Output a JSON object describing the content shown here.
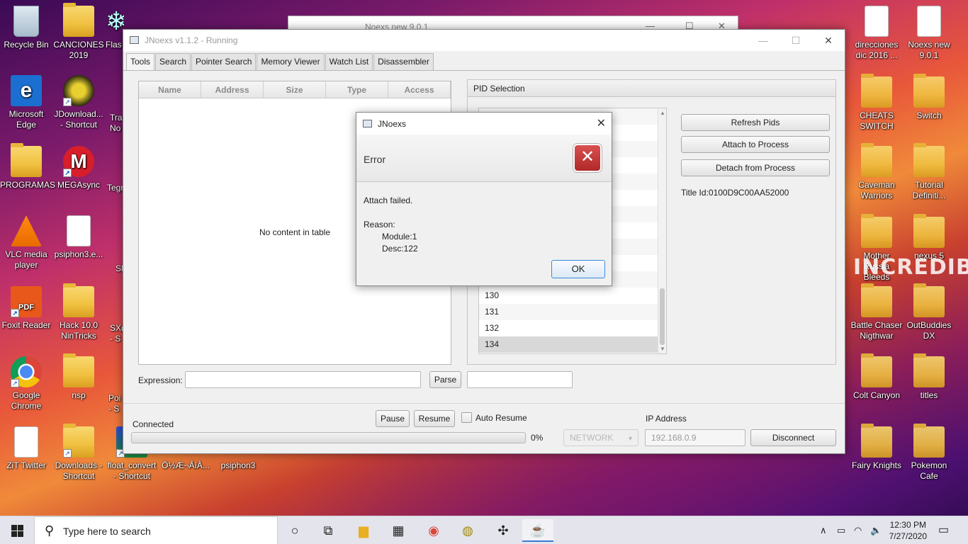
{
  "desktop": {
    "left_icons": [
      {
        "label": "Recycle Bin",
        "icon": "recycle-bin-icon"
      },
      {
        "label": "CANCIONES 2019",
        "icon": "folder-icon"
      },
      {
        "label": "Microsoft Edge",
        "icon": "edge-icon"
      },
      {
        "label": "JDownload... - Shortcut",
        "icon": "jdownloader-icon"
      },
      {
        "label": "PROGRAMAS",
        "icon": "folder-icon"
      },
      {
        "label": "MEGAsync",
        "icon": "mega-icon"
      },
      {
        "label": "VLC media player",
        "icon": "vlc-icon"
      },
      {
        "label": "psiphon3.e...",
        "icon": "file-icon"
      },
      {
        "label": "Foxit Reader",
        "icon": "foxit-icon"
      },
      {
        "label": "Hack 10.0 NinTricks",
        "icon": "folder-icon"
      },
      {
        "label": "Google Chrome",
        "icon": "chrome-icon"
      },
      {
        "label": "nsp",
        "icon": "folder-icon"
      },
      {
        "label": "ZiT Twitter",
        "icon": "document-icon"
      },
      {
        "label": "Downloads - Shortcut",
        "icon": "folder-icon"
      },
      {
        "label": "float_convert - Shortcut",
        "icon": "app-icon"
      },
      {
        "label": "Ö½Æ¬ÂíÀ...",
        "icon": "file-icon"
      },
      {
        "label": "psiphon3",
        "icon": "psiphon-icon"
      }
    ],
    "partial_labels": [
      "Flas",
      "Tra No",
      "Tegr",
      "Sl",
      "SX( - S",
      "Poi - S"
    ],
    "right_icons": [
      {
        "label": "direcciones dic 2016 ...",
        "icon": "document-icon"
      },
      {
        "label": "Noexs new 9.0.1",
        "icon": "file-icon"
      },
      {
        "label": "CHEATS SWITCH",
        "icon": "folder-icon"
      },
      {
        "label": "Switch",
        "icon": "folder-icon"
      },
      {
        "label": "Caveman Warriors",
        "icon": "folder-icon"
      },
      {
        "label": "Tutorial Definiti...",
        "icon": "folder-icon"
      },
      {
        "label": "Mother Russia Bleeds",
        "icon": "folder-icon"
      },
      {
        "label": "nexus 5",
        "icon": "folder-icon"
      },
      {
        "label": "Battle Chaser Nigthwar",
        "icon": "folder-icon"
      },
      {
        "label": "OutBuddies DX",
        "icon": "folder-icon"
      },
      {
        "label": "Colt Canyon",
        "icon": "folder-icon"
      },
      {
        "label": "titles",
        "icon": "folder-icon"
      },
      {
        "label": "Fairy Knights",
        "icon": "folder-icon"
      },
      {
        "label": "Pokemon Cafe",
        "icon": "folder-icon"
      }
    ],
    "wallpaper_text": "INCREDIBLE"
  },
  "background_window": {
    "title": "Noexs new 9.0.1"
  },
  "window": {
    "title": "JNoexs v1.1.2 - Running",
    "tabs": [
      "Tools",
      "Search",
      "Pointer Search",
      "Memory Viewer",
      "Watch List",
      "Disassembler"
    ],
    "active_tab": "Tools",
    "table": {
      "columns": [
        "Name",
        "Address",
        "Size",
        "Type",
        "Access"
      ],
      "empty_text": "No content in table"
    },
    "pid_panel": {
      "title": "PID Selection",
      "rows": [
        "",
        "",
        "",
        "",
        "",
        "",
        "",
        "",
        "",
        "",
        "",
        "130",
        "131",
        "132",
        "134"
      ],
      "selected": "134"
    },
    "buttons": {
      "refresh": "Refresh Pids",
      "attach": "Attach to Process",
      "detach": "Detach from Process",
      "parse": "Parse",
      "pause": "Pause",
      "resume": "Resume",
      "disconnect": "Disconnect"
    },
    "title_id": "Title Id:0100D9C00AA52000",
    "expression_label": "Expression:",
    "expression_value": "",
    "parse_result": "",
    "status": "Connected",
    "progress_percent": 0,
    "progress_text": "0%",
    "auto_resume_label": "Auto Resume",
    "auto_resume_checked": false,
    "connection_type": "NETWORK",
    "ip_label": "IP Address",
    "ip_value": "192.168.0.9"
  },
  "dialog": {
    "title": "JNoexs",
    "header": "Error",
    "message_line1": "Attach failed.",
    "message_line2": "Reason:",
    "message_line3": "Module:1",
    "message_line4": "Desc:122",
    "ok_label": "OK"
  },
  "taskbar": {
    "search_placeholder": "Type here to search",
    "time": "12:30 PM",
    "date": "7/27/2020"
  },
  "colors": {
    "accent": "#3a8ad8",
    "error": "#c03838"
  }
}
